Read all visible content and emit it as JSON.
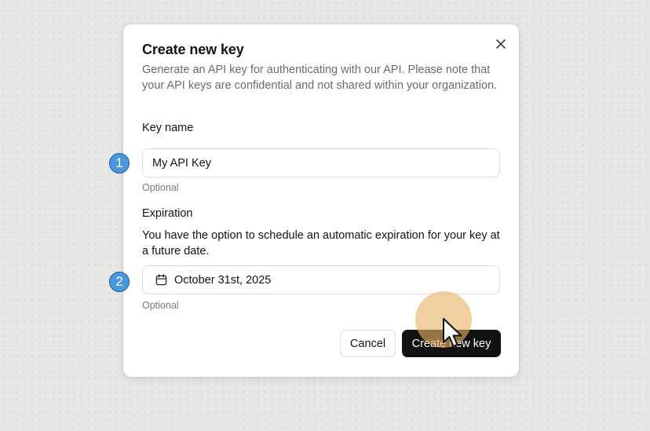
{
  "dialog": {
    "title": "Create new key",
    "description": "Generate an API key for authenticating with our API. Please note that your API keys are confidential and not shared within your organization.",
    "close_icon": "close-icon"
  },
  "key_name": {
    "label": "Key name",
    "value": "My API Key",
    "helper": "Optional"
  },
  "expiration": {
    "label": "Expiration",
    "description": "You have the option to schedule an automatic expiration for your key at a future date.",
    "icon": "calendar-icon",
    "value": "October 31st, 2025",
    "helper": "Optional"
  },
  "actions": {
    "cancel_label": "Cancel",
    "create_label": "Create new key"
  },
  "annotations": {
    "step_1": "1",
    "step_2": "2",
    "cursor_icon": "mouse-pointer-icon",
    "highlight_color": "#e8b264",
    "badge_color": "#4b97df"
  }
}
